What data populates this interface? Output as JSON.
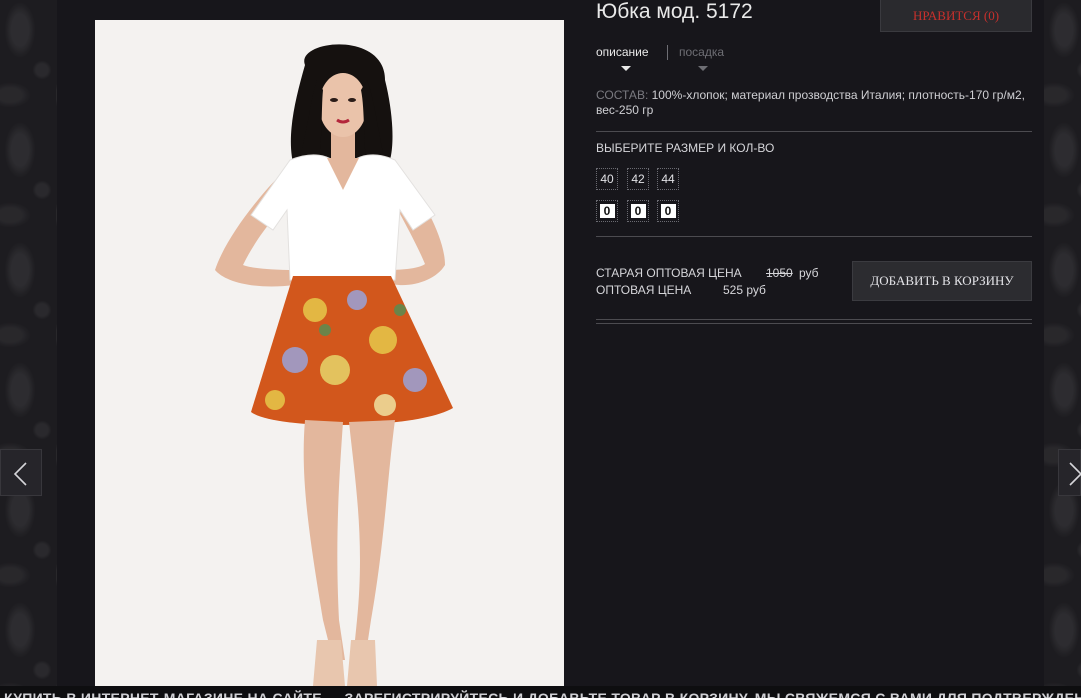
{
  "product": {
    "title": "Юбка мод. 5172",
    "like_label": "НРАВИТСЯ (0)"
  },
  "tabs": [
    {
      "label": "описание",
      "active": true
    },
    {
      "label": "посадка",
      "active": false
    }
  ],
  "composition": {
    "label": "СОСТАВ:",
    "text": "100%-хлопок; материал прозводства Италия; плотность-170 гр/м2, вес-250 гр"
  },
  "sizes": {
    "title": "ВЫБЕРИТЕ РАЗМЕР И КОЛ-ВО",
    "options": [
      "40",
      "42",
      "44"
    ],
    "quantities": [
      "0",
      "0",
      "0"
    ]
  },
  "pricing": {
    "old_label": "СТАРАЯ ОПТОВАЯ ЦЕНА",
    "old_value": "1050",
    "old_currency": "руб",
    "new_label": "ОПТОВАЯ ЦЕНА",
    "new_value": "525 руб"
  },
  "cart_button_label": "ДОБАВИТЬ В КОРЗИНУ",
  "ticker_text": "КУПИТЬ В ИНТЕРНЕТ-МАГАЗИНЕ НА САЙТЕ — ЗАРЕГИСТРИРУЙТЕСЬ И ДОБАВЬТЕ ТОВАР В КОРЗИНУ, МЫ СВЯЖЕМСЯ С ВАМИ ДЛЯ ПОДТВЕРЖДЕНИЯ ЗАКАЗА",
  "icons": {
    "prev": "chevron-left-icon",
    "next": "chevron-right-icon",
    "tab_indicator": "triangle-down-icon"
  },
  "colors": {
    "like_text": "#c8302c",
    "skirt": "#d2571c"
  }
}
